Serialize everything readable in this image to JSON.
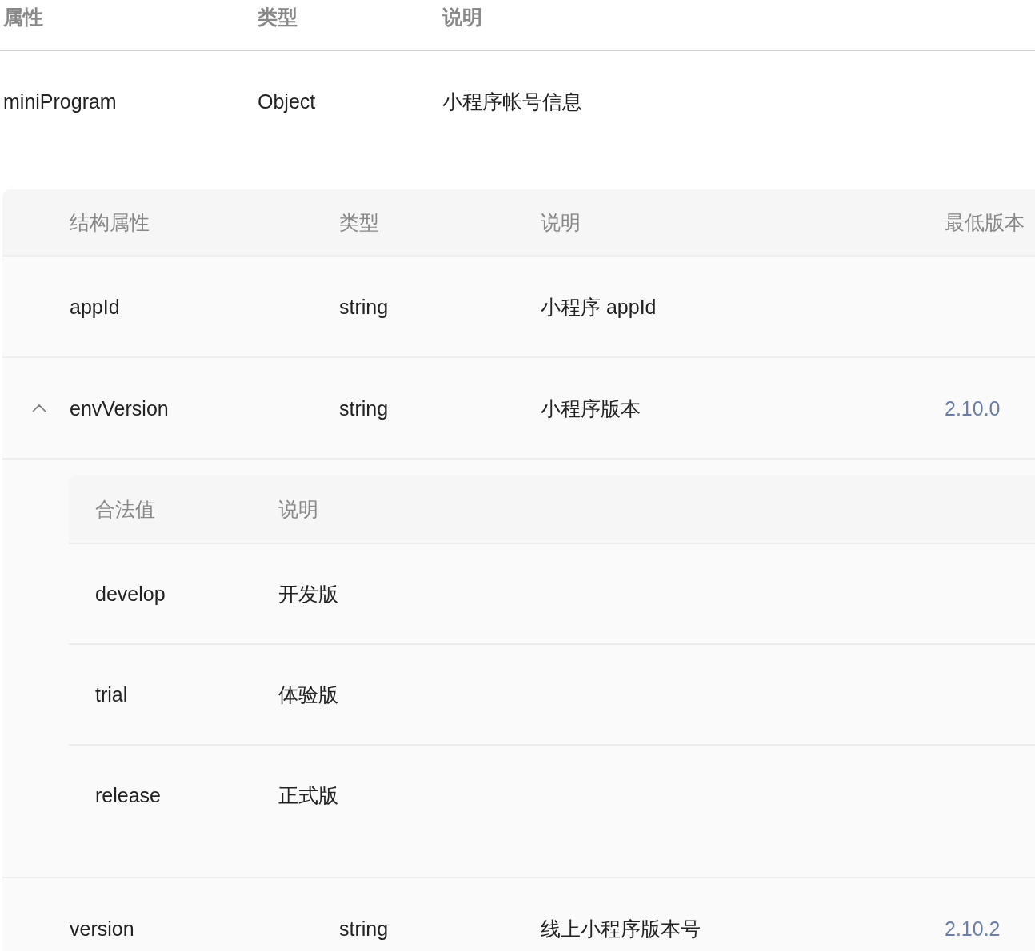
{
  "property_table": {
    "columns": [
      "属性",
      "类型",
      "说明"
    ],
    "rows": [
      {
        "name": "miniProgram",
        "type": "Object",
        "description": "小程序帐号信息"
      }
    ]
  },
  "structure_table": {
    "columns": [
      "结构属性",
      "类型",
      "说明",
      "最低版本"
    ],
    "rows": [
      {
        "name": "appId",
        "type": "string",
        "description": "小程序 appId"
      },
      {
        "name": "envVersion",
        "type": "string",
        "description": "小程序版本",
        "min_version": "2.10.0",
        "expanded": true,
        "values_table": {
          "columns": [
            "合法值",
            "说明"
          ],
          "rows": [
            {
              "value": "develop",
              "description": "开发版"
            },
            {
              "value": "trial",
              "description": "体验版"
            },
            {
              "value": "release",
              "description": "正式版"
            }
          ]
        }
      },
      {
        "name": "version",
        "type": "string",
        "description": "线上小程序版本号",
        "min_version": "2.10.2"
      }
    ]
  }
}
